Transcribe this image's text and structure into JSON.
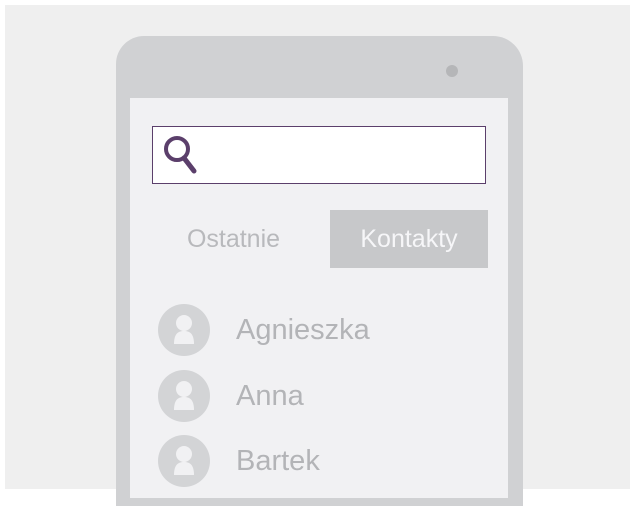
{
  "search": {
    "value": "",
    "placeholder": ""
  },
  "tabs": [
    {
      "label": "Ostatnie",
      "active": false
    },
    {
      "label": "Kontakty",
      "active": true
    }
  ],
  "contacts": [
    {
      "name": "Agnieszka"
    },
    {
      "name": "Anna"
    },
    {
      "name": "Bartek"
    }
  ],
  "colors": {
    "background": "#efefef",
    "phone_frame": "#d0d1d3",
    "screen": "#f1f1f3",
    "accent": "#5b3f6b",
    "active_tab_bg": "#c7c8ca",
    "avatar": "#d3d4d6",
    "muted_text": "#b3b4b7"
  },
  "icons": {
    "search": "magnifier",
    "avatar": "person-silhouette"
  }
}
